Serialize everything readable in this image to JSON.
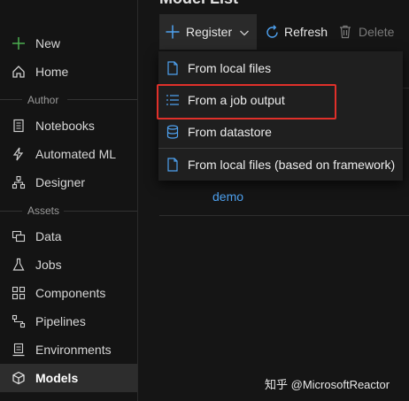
{
  "sidebar": {
    "new_label": "New",
    "home_label": "Home",
    "author_section": "Author",
    "author_items": [
      {
        "label": "Notebooks",
        "icon": "notebook-icon"
      },
      {
        "label": "Automated ML",
        "icon": "automated-ml-icon"
      },
      {
        "label": "Designer",
        "icon": "designer-icon"
      }
    ],
    "assets_section": "Assets",
    "assets_items": [
      {
        "label": "Data",
        "icon": "data-icon"
      },
      {
        "label": "Jobs",
        "icon": "flask-icon"
      },
      {
        "label": "Components",
        "icon": "components-icon"
      },
      {
        "label": "Pipelines",
        "icon": "pipelines-icon"
      },
      {
        "label": "Environments",
        "icon": "environments-icon"
      },
      {
        "label": "Models",
        "icon": "cube-icon",
        "active": true
      }
    ]
  },
  "main": {
    "title": "Model List",
    "toolbar": {
      "register_label": "Register",
      "refresh_label": "Refresh",
      "delete_label": "Delete"
    },
    "rows": [
      {
        "name": "demo"
      }
    ]
  },
  "register_menu": {
    "items": [
      {
        "label": "From local files",
        "icon": "file-icon"
      },
      {
        "label": "From a job output",
        "icon": "list-icon",
        "highlighted": true
      },
      {
        "label": "From datastore",
        "icon": "database-icon"
      },
      {
        "label": "From local files (based on framework)",
        "icon": "file-icon"
      }
    ]
  },
  "watermark": {
    "zh": "知乎",
    "handle": "@MicrosoftReactor"
  },
  "colors": {
    "accent_blue": "#4ea1ef",
    "new_green": "#4caf50",
    "highlight_red": "#e0302a"
  }
}
